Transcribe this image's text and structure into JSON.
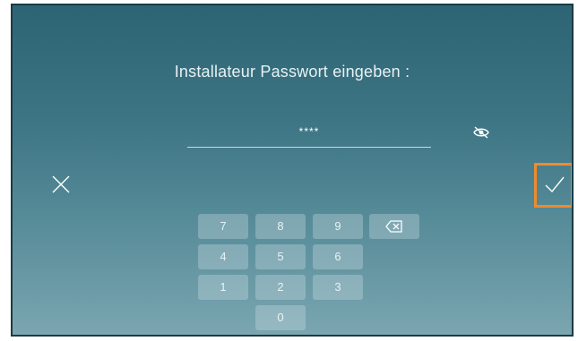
{
  "prompt": {
    "title": "Installateur Passwort eingeben :"
  },
  "password": {
    "masked_value": "****"
  },
  "icons": {
    "visibility_toggle": "eye-slash-icon",
    "cancel": "close-icon",
    "confirm": "checkmark-icon",
    "backspace": "backspace-icon"
  },
  "keypad": {
    "keys": [
      "7",
      "8",
      "9",
      "4",
      "5",
      "6",
      "1",
      "2",
      "3",
      "0"
    ]
  },
  "colors": {
    "confirm_highlight": "#f08a2c",
    "background_top": "#2d6473",
    "background_bottom": "#7aa6b0"
  }
}
